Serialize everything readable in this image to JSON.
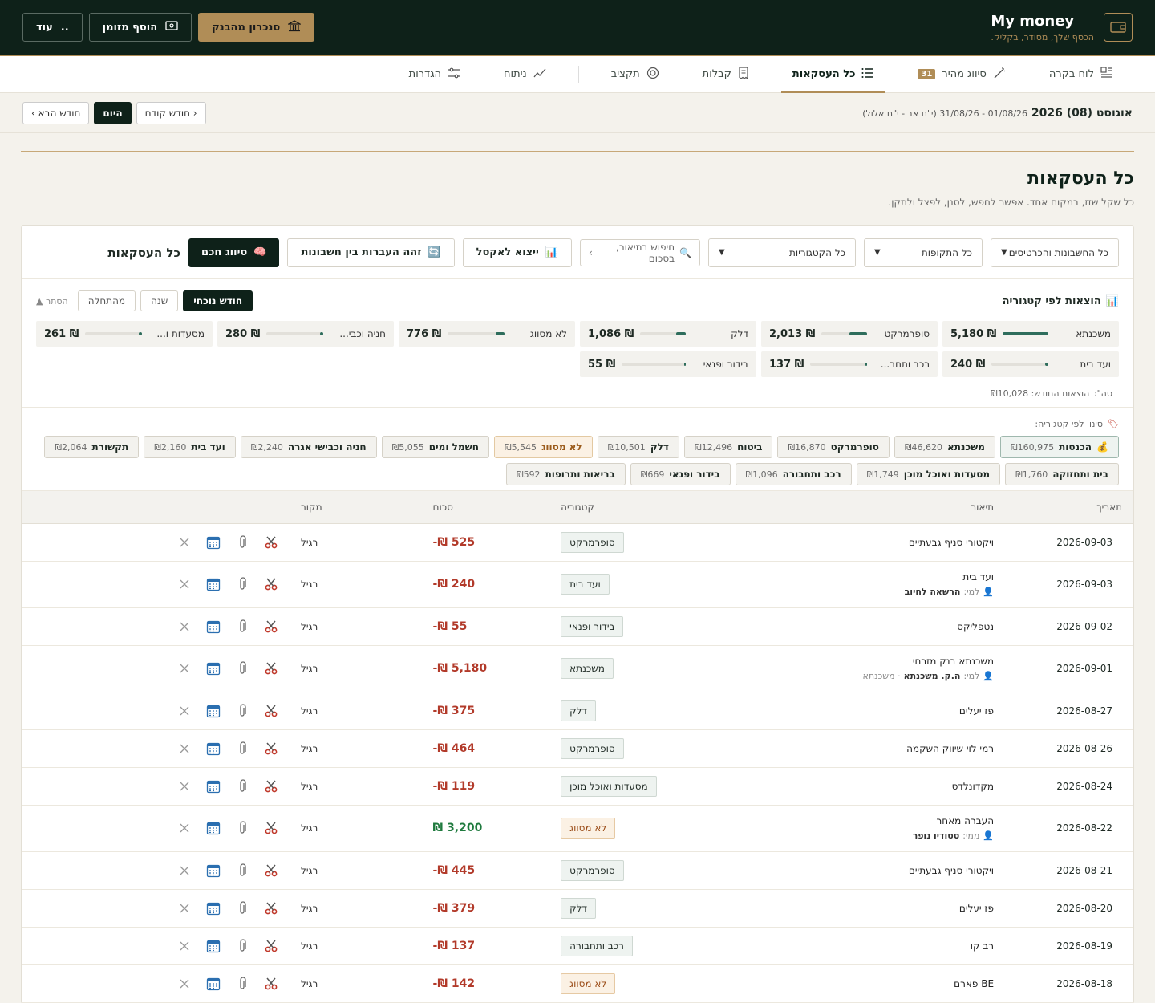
{
  "brand": {
    "title": "My money",
    "subtitle": "הכסף שלך, מסודר, בקליק."
  },
  "top_actions": {
    "sync": "סנכרון מהבנק",
    "add_cash": "הוסף מזומן",
    "more": "עוד",
    "more_dots": ".."
  },
  "nav": [
    {
      "label": "לוח בקרה",
      "icon": "dashboard-icon"
    },
    {
      "label": "סיווג מהיר",
      "icon": "wand-icon",
      "badge": "31"
    },
    {
      "label": "כל העסקאות",
      "icon": "list-icon",
      "active": true
    },
    {
      "label": "קבלות",
      "icon": "receipt-icon"
    },
    {
      "label": "תקציב",
      "icon": "target-icon"
    },
    {
      "label": "ניתוח",
      "icon": "trend-icon"
    },
    {
      "label": "הגדרות",
      "icon": "sliders-icon"
    }
  ],
  "datebar": {
    "title": "אוגוסט (08) 2026",
    "range": "01/08/26 - 31/08/26 (י\"ח אב - י\"ח אלול)",
    "prev": "חודש קודם",
    "today": "היום",
    "next": "חודש הבא"
  },
  "page": {
    "title": "כל העסקאות",
    "subtitle": "כל שקל שזז, במקום אחד. אפשר לחפש, לסנן, לפצל ולתקן."
  },
  "toolbar": {
    "title": "כל העסקאות",
    "smart": "סיווג חכם",
    "transfers": "זהה העברות בין חשבונות",
    "export": "ייצוא לאקסל",
    "search_placeholder": "חיפוש בתיאור, בסכום",
    "categories": "כל הקטגוריות",
    "periods": "כל התקופות",
    "accounts": "כל החשבונות והכרטיסים"
  },
  "spend": {
    "title": "הוצאות לפי קטגוריה",
    "tabs": [
      "חודש נוכחי",
      "שנה",
      "מהתחלה"
    ],
    "hide": "הסתר",
    "total": "סה\"כ הוצאות החודש: ₪10,028",
    "cats": [
      {
        "name": "משכנתא",
        "value": "₪ 5,180",
        "fraction": 1.0
      },
      {
        "name": "סופרמרקט",
        "value": "₪ 2,013",
        "fraction": 0.39
      },
      {
        "name": "דלק",
        "value": "₪ 1,086",
        "fraction": 0.21
      },
      {
        "name": "לא מסווג",
        "value": "₪ 776",
        "fraction": 0.15
      },
      {
        "name": "חניה וכבי...",
        "value": "₪ 280",
        "fraction": 0.05
      },
      {
        "name": "מסעדות ו...",
        "value": "₪ 261",
        "fraction": 0.05
      },
      {
        "name": "ועד בית",
        "value": "₪ 240",
        "fraction": 0.05
      },
      {
        "name": "רכב ותחב...",
        "value": "₪ 137",
        "fraction": 0.03
      },
      {
        "name": "בידור ופנאי",
        "value": "₪ 55",
        "fraction": 0.01
      }
    ]
  },
  "chips": {
    "title": "סינון לפי קטגוריה:",
    "items": [
      {
        "name": "הכנסות",
        "value": "₪160,975",
        "kind": "first"
      },
      {
        "name": "משכנתא",
        "value": "₪46,620"
      },
      {
        "name": "סופרמרקט",
        "value": "₪16,870"
      },
      {
        "name": "ביטוח",
        "value": "₪12,496"
      },
      {
        "name": "דלק",
        "value": "₪10,501"
      },
      {
        "name": "לא מסווג",
        "value": "₪5,545",
        "kind": "warn"
      },
      {
        "name": "חשמל ומים",
        "value": "₪5,055"
      },
      {
        "name": "חניה וכבישי אגרה",
        "value": "₪2,240"
      },
      {
        "name": "ועד בית",
        "value": "₪2,160"
      },
      {
        "name": "תקשורת",
        "value": "₪2,064"
      },
      {
        "name": "בית ותחזוקה",
        "value": "₪1,760"
      },
      {
        "name": "מסעדות ואוכל מוכן",
        "value": "₪1,749"
      },
      {
        "name": "רכב ותחבורה",
        "value": "₪1,096"
      },
      {
        "name": "בידור ופנאי",
        "value": "₪669"
      },
      {
        "name": "בריאות ותרופות",
        "value": "₪592"
      }
    ]
  },
  "table": {
    "headers": {
      "date": "תאריך",
      "desc": "תיאור",
      "cat": "קטגוריה",
      "amount": "סכום",
      "source": "מקור"
    },
    "rows": [
      {
        "date": "2026-09-03",
        "desc": "ויקטורי סניף גבעתיים",
        "cat": "סופרמרקט",
        "amount": "-₪ 525",
        "source": "רגיל"
      },
      {
        "date": "2026-09-03",
        "desc": "ועד בית",
        "sub_pre": "למי:",
        "sub_name": "הרשאה לחיוב",
        "cat": "ועד בית",
        "amount": "-₪ 240",
        "source": "רגיל"
      },
      {
        "date": "2026-09-02",
        "desc": "נטפליקס",
        "cat": "בידור ופנאי",
        "amount": "-₪ 55",
        "source": "רגיל"
      },
      {
        "date": "2026-09-01",
        "desc": "משכנתא בנק מזרחי",
        "sub_pre": "למי:",
        "sub_name": "ה.ק. משכנתא",
        "sub_post": "· משכנתא",
        "cat": "משכנתא",
        "amount": "-₪ 5,180",
        "source": "רגיל"
      },
      {
        "date": "2026-08-27",
        "desc": "פז יעלים",
        "cat": "דלק",
        "amount": "-₪ 375",
        "source": "רגיל"
      },
      {
        "date": "2026-08-26",
        "desc": "רמי לוי שיווק השקמה",
        "cat": "סופרמרקט",
        "amount": "-₪ 464",
        "source": "רגיל"
      },
      {
        "date": "2026-08-24",
        "desc": "מקדונלדס",
        "cat": "מסעדות ואוכל מוכן",
        "amount": "-₪ 119",
        "source": "רגיל"
      },
      {
        "date": "2026-08-22",
        "desc": "העברה מאחר",
        "sub_pre": "ממי:",
        "sub_name": "סטודיו נופר",
        "cat": "לא מסווג",
        "cat_kind": "warn",
        "amount": "₪ 3,200",
        "positive": true,
        "source": "רגיל"
      },
      {
        "date": "2026-08-21",
        "desc": "ויקטורי סניף גבעתיים",
        "cat": "סופרמרקט",
        "amount": "-₪ 445",
        "source": "רגיל"
      },
      {
        "date": "2026-08-20",
        "desc": "פז יעלים",
        "cat": "דלק",
        "amount": "-₪ 379",
        "source": "רגיל"
      },
      {
        "date": "2026-08-19",
        "desc": "רב קו",
        "cat": "רכב ותחבורה",
        "amount": "-₪ 137",
        "source": "רגיל"
      },
      {
        "date": "2026-08-18",
        "desc": "BE פארם",
        "cat": "לא מסווג",
        "cat_kind": "warn",
        "amount": "-₪ 142",
        "source": "רגיל"
      }
    ]
  },
  "colors": {
    "dark": "#0e2119",
    "gold": "#b08d57",
    "negative": "#b23a2a",
    "positive": "#1f7a3e",
    "bar": "#2e6d5c"
  }
}
